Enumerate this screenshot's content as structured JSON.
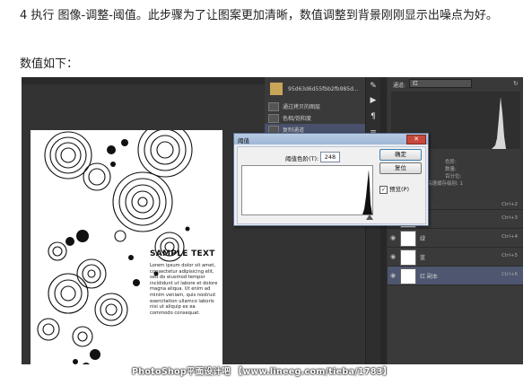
{
  "intro": {
    "line1": "4 执行 图像-调整-阈值。此步骤为了让图案更加清晰，数值调整到背景刚刚显示出噪点为好。",
    "line2": "数值如下："
  },
  "history": {
    "snapshot_name": "95d63d6d55fbb2fb985d...",
    "items": [
      "通过拷贝的图层",
      "色相/饱和度",
      "复制通道"
    ]
  },
  "canvas": {
    "sample_title": "SAMPLE TEXT",
    "sample_body": "Lorem ipsum dolor sit amet, consectetur adipisicing elit, sed do eiusmod tempor incididunt ut labore et dolore magna aliqua. Ut enim ad minim veniam, quis nostrud exercitation ullamco laboris nisi ut aliquip ex ea commodo consequat."
  },
  "histogram_panel": {
    "channel_label": "通道:",
    "channel_value": "红",
    "stats": [
      "色阶:",
      "数量:",
      "百分位:",
      "高速缓存级别: 1"
    ]
  },
  "layers": [
    {
      "name": "红",
      "shortcut": "Ctrl+3",
      "selected": false
    },
    {
      "name": "绿",
      "shortcut": "Ctrl+4",
      "selected": false
    },
    {
      "name": "蓝",
      "shortcut": "Ctrl+5",
      "selected": false
    },
    {
      "name": "红 副本",
      "shortcut": "Ctrl+6",
      "selected": true
    }
  ],
  "layer_top_shortcut": "Ctrl+2",
  "dialog": {
    "title": "阈值",
    "level_label": "阈值色阶(T):",
    "level_value": "248",
    "ok_label": "确定",
    "reset_label": "复位",
    "preview_label": "预览(P)",
    "preview_checked": true
  },
  "watermark": "PhotoShop平面设计吧 【www.lineeg.com/tieba/1783】",
  "colors": {
    "workspace": "#333333",
    "selection": "#4e5670",
    "dialog_bg": "#f0f0f0",
    "close_button": "#c8483c"
  }
}
